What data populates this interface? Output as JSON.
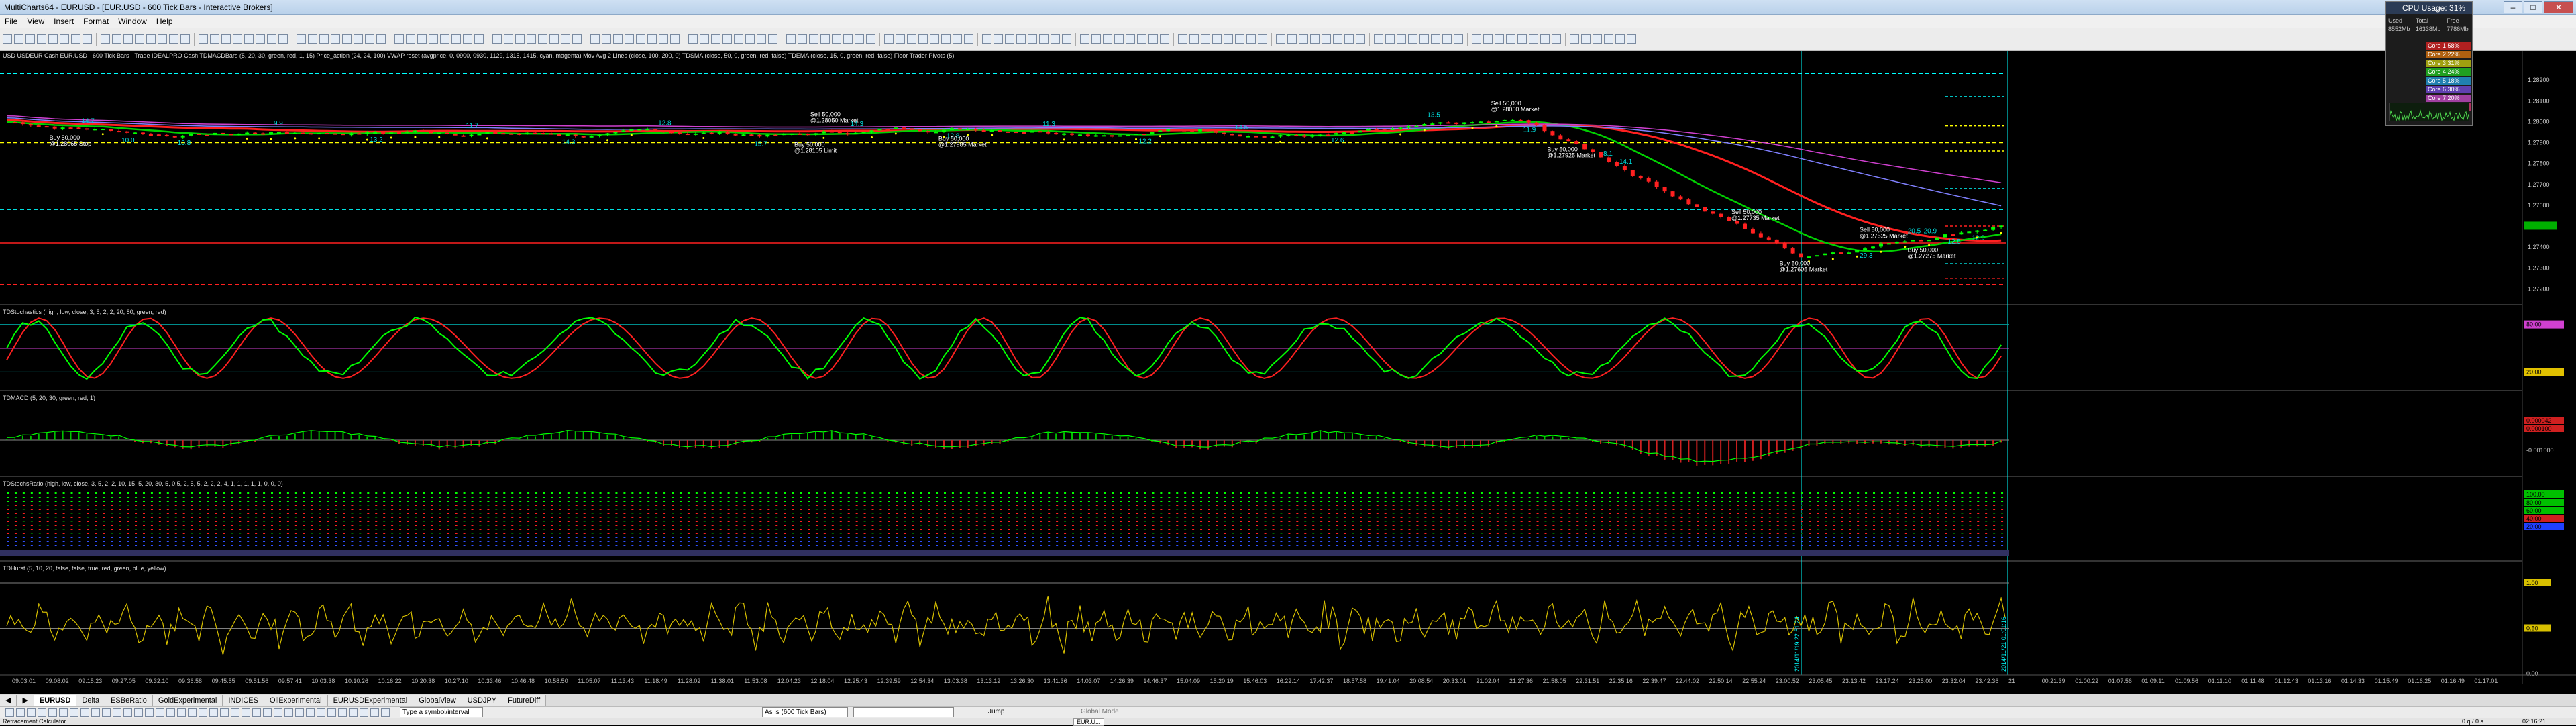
{
  "window": {
    "title": "MultiCharts64 - EURUSD - [EUR.USD - 600 Tick Bars - Interactive Brokers]",
    "minimize": "–",
    "maximize": "□",
    "close": "✕"
  },
  "menu": [
    "File",
    "View",
    "Insert",
    "Format",
    "Window",
    "Help"
  ],
  "chart": {
    "header_main": "USD USDEUR Cash EUR.USD  ·  600 Tick Bars  ·  Trade  IDEALPRO  Cash",
    "header_studies": "TDMACDBars (5, 20, 30, green, red, 1, 15)  Price_action (24, 24, 100)  VWAP reset (avgprice, 0, 0900, 0930, 1129, 1315, 1415, cyan, magenta)  Mov Avg 2 Lines (close, 100, 200, 0)  TDSMA (close, 50, 0, green, red, false)  TDEMA (close, 15, 0, green, red, false)  Floor Trader Pivots (5)",
    "panes": [
      {
        "label": "TDStochastics (high, low, close, 3, 5, 2, 2, 20, 80, green, red)"
      },
      {
        "label": "TDMACD (5, 20, 30, green, red, 1)"
      },
      {
        "label": "TDStochsRatio (high, low, close, 3, 5, 2, 2, 10, 15, 5, 20, 30, 5, 0.5, 2, 5, 5, 2, 2, 2, 4, 1, 1, 1, 1, 1, 0, 0, 0)"
      },
      {
        "label": "TDHurst (5, 10, 20, false, false, true, red, green, blue, yellow)"
      }
    ],
    "price_labels": [
      "1.28200",
      "1.28100",
      "1.28000",
      "1.27900",
      "1.27800",
      "1.27700",
      "1.27600",
      "1.27500",
      "1.27400",
      "1.27300",
      "1.27200"
    ],
    "stoch_labels": [
      "80.00",
      "20.00"
    ],
    "macd_labels": [
      "0.000042",
      "0.000100",
      "-0.001000"
    ],
    "ratio_labels": [
      "100.00",
      "80.00",
      "60.00",
      "40.00",
      "20.00"
    ],
    "hurst_labels": [
      "1.00",
      "0.50",
      "0.00"
    ],
    "trades": [
      {
        "text": "Buy 50,000",
        "sub": "@1.28065 Stop"
      },
      {
        "text": "Sell 50,000",
        "sub": "@1.28050 Market"
      },
      {
        "text": "Buy 50,000",
        "sub": "@1.28105 Limit"
      },
      {
        "text": "Buy 50,000",
        "sub": "@1.27985 Market"
      },
      {
        "text": "Sell 50,000",
        "sub": "@1.28050 Market"
      },
      {
        "text": "Buy 50,000",
        "sub": "@1.27925 Market"
      },
      {
        "text": "Sell 50,000",
        "sub": "@1.27735 Market"
      },
      {
        "text": "Sell 50,000",
        "sub": "@1.27525 Market"
      },
      {
        "text": "Buy 50,000",
        "sub": "@1.27605 Market"
      },
      {
        "text": "Buy 50,000",
        "sub": "@1.27275 Market"
      }
    ],
    "bar_counts": [
      "14.7",
      "10.8",
      "9.9",
      "13.2",
      "11.7",
      "14.3",
      "12.8",
      "15.7",
      "14.3",
      "12.8",
      "11.3",
      "12.2",
      "14.5",
      "12.6",
      "13.5",
      "11.9",
      "14.1",
      "10.0",
      "8.1",
      "29.3",
      "20.9",
      "12.9",
      "20.5",
      "12.5"
    ],
    "time_labels": [
      "09:03:01",
      "09:08:02",
      "09:15:23",
      "09:27:05",
      "09:32:10",
      "09:36:58",
      "09:45:55",
      "09:51:56",
      "09:57:41",
      "10:03:38",
      "10:10:26",
      "10:16:22",
      "10:20:38",
      "10:27:10",
      "10:33:46",
      "10:46:48",
      "10:58:50",
      "11:05:07",
      "11:13:43",
      "11:18:49",
      "11:28:02",
      "11:38:01",
      "11:53:08",
      "12:04:23",
      "12:18:04",
      "12:25:43",
      "12:39:59",
      "12:54:34",
      "13:03:38",
      "13:13:12",
      "13:26:30",
      "13:41:36",
      "14:03:07",
      "14:26:39",
      "14:46:37",
      "15:04:09",
      "15:20:19",
      "15:46:03",
      "16:22:14",
      "17:42:37",
      "18:57:58",
      "19:41:04",
      "20:08:54",
      "20:33:01",
      "21:02:04",
      "21:27:36",
      "21:58:05",
      "22:31:51",
      "22:35:16",
      "22:39:47",
      "22:44:02",
      "22:50:14",
      "22:55:24",
      "23:00:52",
      "23:05:45",
      "23:13:42",
      "23:17:24",
      "23:25:00",
      "23:32:04",
      "23:42:36",
      "21",
      "00:21:39",
      "01:00:22",
      "01:07:56",
      "01:09:11",
      "01:09:56",
      "01:11:10",
      "01:11:48",
      "01:12:43",
      "01:13:16",
      "01:14:33",
      "01:15:49",
      "01:16:25",
      "01:16:49",
      "01:17:01"
    ],
    "v_time_label_1": "2014/11/19 22:51:24",
    "v_time_label_2": "2014/11/21 01:01:16"
  },
  "cpu_panel": {
    "title": "CPU Usage: 31%",
    "rows": [
      [
        "Used",
        "Total",
        "Free"
      ],
      [
        "8552Mb",
        "16338Mb",
        "7786Mb"
      ]
    ],
    "cores": [
      "Core 1 58%",
      "Core 2 22%",
      "Core 3 31%",
      "Core 4 24%",
      "Core 5 18%",
      "Core 6 30%",
      "Core 7 20%",
      "Core 8 46%"
    ]
  },
  "tabs": [
    "EURUSD",
    "Delta",
    "ESBeRatio",
    "GoldExperimental",
    "INDICES",
    "OilExperimental",
    "EURUSDExperimental",
    "GlobalView",
    "USDJPY",
    "FutureDiff"
  ],
  "drawbar": {
    "symbol_placeholder": "Type a symbol/interval",
    "resolution": "As is (600 Tick Bars)",
    "jump": "Jump",
    "global_mode": "Global Mode",
    "taskbar_item": "EUR.U..."
  },
  "status": {
    "left": "Retracement Calculator",
    "right_1": "0 q / 0 s",
    "right_2": "02:16:21"
  },
  "colors": {
    "up": "#00ff00",
    "down": "#ff2020",
    "ma_red": "#ff2020",
    "ma_green": "#00ff00",
    "cyan": "#00ffff",
    "yellow": "#ffff00",
    "magenta": "#ff00ff"
  }
}
